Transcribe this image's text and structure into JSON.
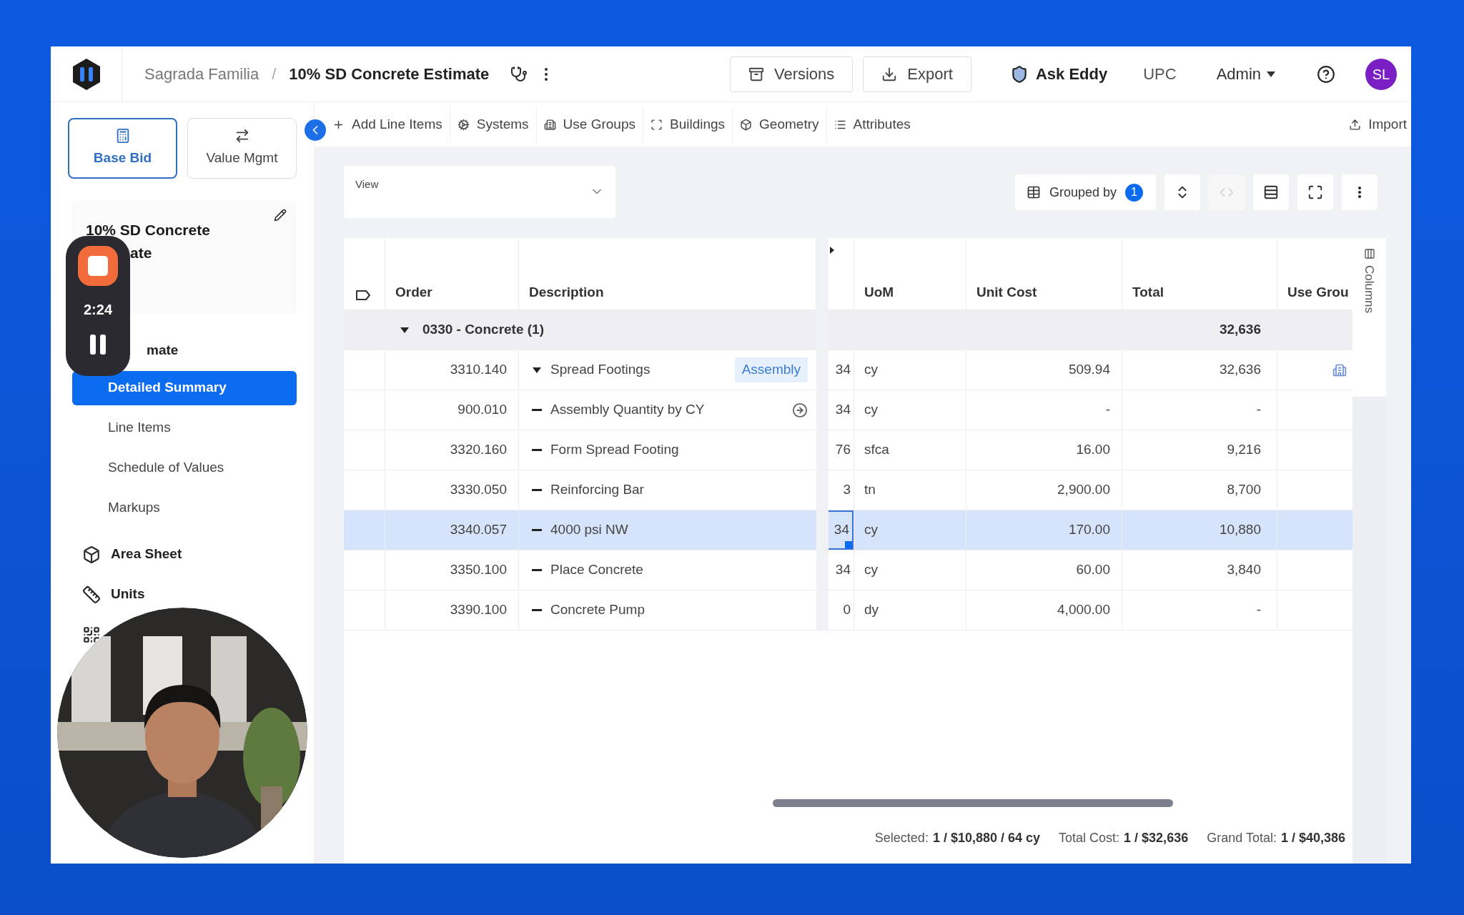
{
  "header": {
    "project": "Sagrada Familia",
    "separator": "/",
    "title": "10% SD Concrete Estimate"
  },
  "header_buttons": [
    {
      "label": "Versions",
      "kind": "versions"
    },
    {
      "label": "Export",
      "kind": "export"
    }
  ],
  "assistant": "Ask Eddy",
  "org": "UPC",
  "role_menu": "Admin",
  "avatar": "SL",
  "modes": [
    {
      "label": "Base Bid",
      "kind": "base",
      "selected": true
    },
    {
      "label": "Value Mgmt",
      "kind": "value",
      "selected": false
    }
  ],
  "toolbar": [
    {
      "label": "Add Line Items",
      "kind": "add"
    },
    {
      "label": "Systems",
      "kind": "systems"
    },
    {
      "label": "Use Groups",
      "kind": "usegroups"
    },
    {
      "label": "Buildings",
      "kind": "buildings"
    },
    {
      "label": "Geometry",
      "kind": "geometry"
    },
    {
      "label": "Attributes",
      "kind": "attributes"
    }
  ],
  "import": "Import",
  "sidebar": {
    "title": "10% SD Concrete",
    "title_rest": "ate",
    "section": "mate",
    "items": [
      {
        "label": "Detailed Summary",
        "selected": true
      },
      {
        "label": "Line Items",
        "selected": false
      },
      {
        "label": "Schedule of Values",
        "selected": false
      },
      {
        "label": "Markups",
        "selected": false
      }
    ],
    "tools": [
      {
        "label": "Area Sheet",
        "kind": "area"
      },
      {
        "label": "Units",
        "kind": "units"
      },
      {
        "kind": "qr"
      }
    ]
  },
  "view": {
    "label": "View"
  },
  "grouped_by": {
    "label": "Grouped by",
    "count": "1"
  },
  "table": {
    "columns": [
      "Order",
      "Description",
      "UoM",
      "Unit Cost",
      "Total",
      "Use Grou"
    ],
    "group": {
      "label": "0330 - Concrete (1)",
      "total": "32,636",
      "expanded": true
    },
    "rows": [
      {
        "order": "3310.140",
        "description": "Spread Footings",
        "kind": "assembly",
        "tag": "Assembly",
        "navigate": false,
        "column_3": "34",
        "uom": "cy",
        "unit_cost": "509.94",
        "total": "32,636",
        "use_group_icon": true,
        "selected": false
      },
      {
        "order": "900.010",
        "description": "Assembly Quantity by CY",
        "kind": "item",
        "navigate": true,
        "column_3": "34",
        "uom": "cy",
        "unit_cost": "-",
        "total": "-",
        "use_group_icon": false,
        "selected": false
      },
      {
        "order": "3320.160",
        "description": "Form Spread Footing",
        "kind": "item",
        "navigate": false,
        "column_3": "76",
        "uom": "sfca",
        "unit_cost": "16.00",
        "total": "9,216",
        "use_group_icon": false,
        "selected": false
      },
      {
        "order": "3330.050",
        "description": "Reinforcing Bar",
        "kind": "item",
        "navigate": false,
        "column_3": "3",
        "uom": "tn",
        "unit_cost": "2,900.00",
        "total": "8,700",
        "use_group_icon": false,
        "selected": false
      },
      {
        "order": "3340.057",
        "description": "4000 psi NW",
        "kind": "item",
        "navigate": false,
        "column_3": "34",
        "uom": "cy",
        "unit_cost": "170.00",
        "total": "10,880",
        "use_group_icon": false,
        "selected": true
      },
      {
        "order": "3350.100",
        "description": "Place Concrete",
        "kind": "item",
        "navigate": false,
        "column_3": "34",
        "uom": "cy",
        "unit_cost": "60.00",
        "total": "3,840",
        "use_group_icon": false,
        "selected": false
      },
      {
        "order": "3390.100",
        "description": "Concrete Pump",
        "kind": "item",
        "navigate": false,
        "column_3": "0",
        "uom": "dy",
        "unit_cost": "4,000.00",
        "total": "-",
        "use_group_icon": false,
        "selected": false
      }
    ]
  },
  "columns_panel": "Columns",
  "footer": [
    {
      "label": "Selected:",
      "value": "1 / $10,880 / 64 cy"
    },
    {
      "label": "Total Cost:",
      "value": "1 / $32,636"
    },
    {
      "label": "Grand Total:",
      "value": "1 / $40,386"
    }
  ],
  "recorder": {
    "time": "2:24"
  }
}
